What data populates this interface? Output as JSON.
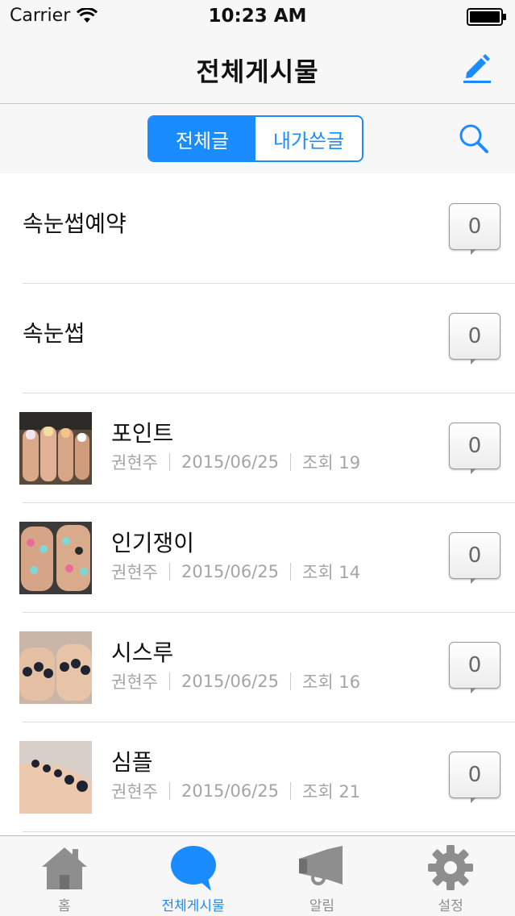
{
  "statusbar": {
    "carrier": "Carrier",
    "time": "10:23 AM"
  },
  "navbar": {
    "title": "전체게시물",
    "compose_icon": "pencil-icon"
  },
  "segment": {
    "items": [
      "전체글",
      "내가쓴글"
    ],
    "selected": "전체글",
    "search_icon": "search-icon"
  },
  "posts": [
    {
      "title": "속눈썹예약",
      "count": "0"
    },
    {
      "title": "속눈썹",
      "count": "0"
    },
    {
      "title": "포인트",
      "author": "권현주",
      "date": "2015/06/25",
      "views": "조회 19",
      "count": "0"
    },
    {
      "title": "인기쟁이",
      "author": "권현주",
      "date": "2015/06/25",
      "views": "조회 14",
      "count": "0"
    },
    {
      "title": "시스루",
      "author": "권현주",
      "date": "2015/06/25",
      "views": "조회 16",
      "count": "0"
    },
    {
      "title": "심플",
      "author": "권현주",
      "date": "2015/06/25",
      "views": "조회 21",
      "count": "0"
    }
  ],
  "tabbar": {
    "tabs": [
      {
        "label": "홈",
        "icon": "home-icon"
      },
      {
        "label": "전체게시물",
        "icon": "speech-bubble-icon"
      },
      {
        "label": "알림",
        "icon": "megaphone-icon"
      },
      {
        "label": "설정",
        "icon": "gear-icon"
      }
    ],
    "active": "전체게시물"
  },
  "colors": {
    "accent": "#1a8cff",
    "meta_text": "#a5a5a5",
    "bar_background": "#f7f7f7",
    "inactive_tab": "#8e8e8e"
  }
}
